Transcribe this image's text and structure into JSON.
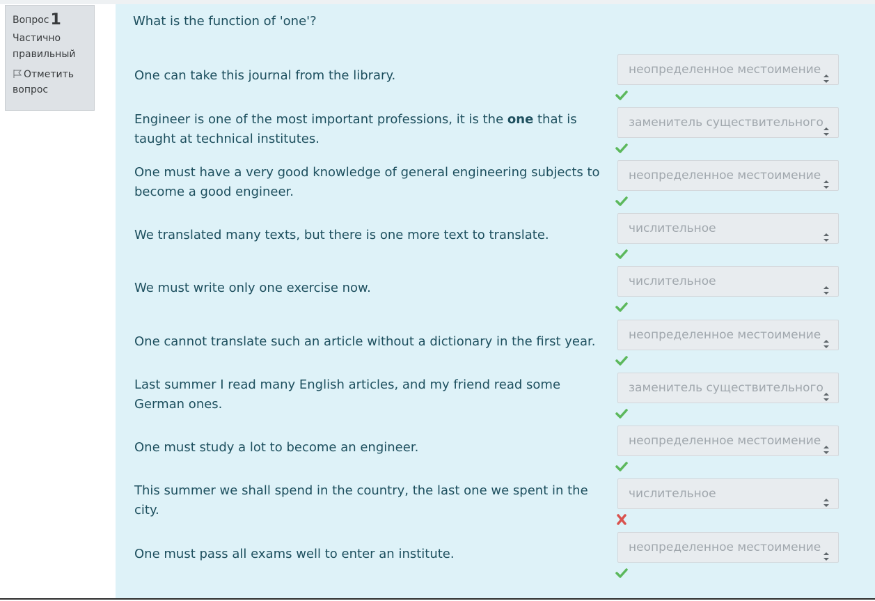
{
  "info": {
    "question_label": "Вопрос",
    "question_number": "1",
    "state_line1": "Частично",
    "state_line2": "правильный",
    "flag_line1": "Отметить",
    "flag_line2": "вопрос"
  },
  "question": {
    "text": "What is the function of 'one'?"
  },
  "items": [
    {
      "pre": "One can take this journal from the library.",
      "bold": "",
      "post": "",
      "answer": "неопределенное местоимение",
      "status": "correct"
    },
    {
      "pre": "Engineer is one of the most important professions, it is the ",
      "bold": "one",
      "post": " that is taught at technical institutes.",
      "answer": "заменитель существительного",
      "status": "correct"
    },
    {
      "pre": "One must have a very good knowledge of general engineering subjects to become a good engineer.",
      "bold": "",
      "post": "",
      "answer": "неопределенное местоимение",
      "status": "correct"
    },
    {
      "pre": "We translated many texts, but there is one more text to translate.",
      "bold": "",
      "post": "",
      "answer": "числительное",
      "status": "correct"
    },
    {
      "pre": "We must write only one exercise now.",
      "bold": "",
      "post": "",
      "answer": "числительное",
      "status": "correct"
    },
    {
      "pre": "One cannot translate such an article without a dictionary in the first year.",
      "bold": "",
      "post": "",
      "answer": "неопределенное местоимение",
      "status": "correct"
    },
    {
      "pre": "Last summer I read many English articles, and my friend read some German ones.",
      "bold": "",
      "post": "",
      "answer": "заменитель существительного",
      "status": "correct"
    },
    {
      "pre": "One must study a lot to become an engineer.",
      "bold": "",
      "post": "",
      "answer": "неопределенное местоимение",
      "status": "correct"
    },
    {
      "pre": "This summer we shall spend in the country, the last one we spent in the city.",
      "bold": "",
      "post": "",
      "answer": "числительное",
      "status": "incorrect"
    },
    {
      "pre": "One must pass all exams well to enter an institute.",
      "bold": "",
      "post": "",
      "answer": "неопределенное местоимение",
      "status": "correct"
    }
  ],
  "colors": {
    "correct": "#5cb85c",
    "incorrect": "#d9534f",
    "panel_bg": "#def2f8",
    "text": "#1d4f5e"
  }
}
